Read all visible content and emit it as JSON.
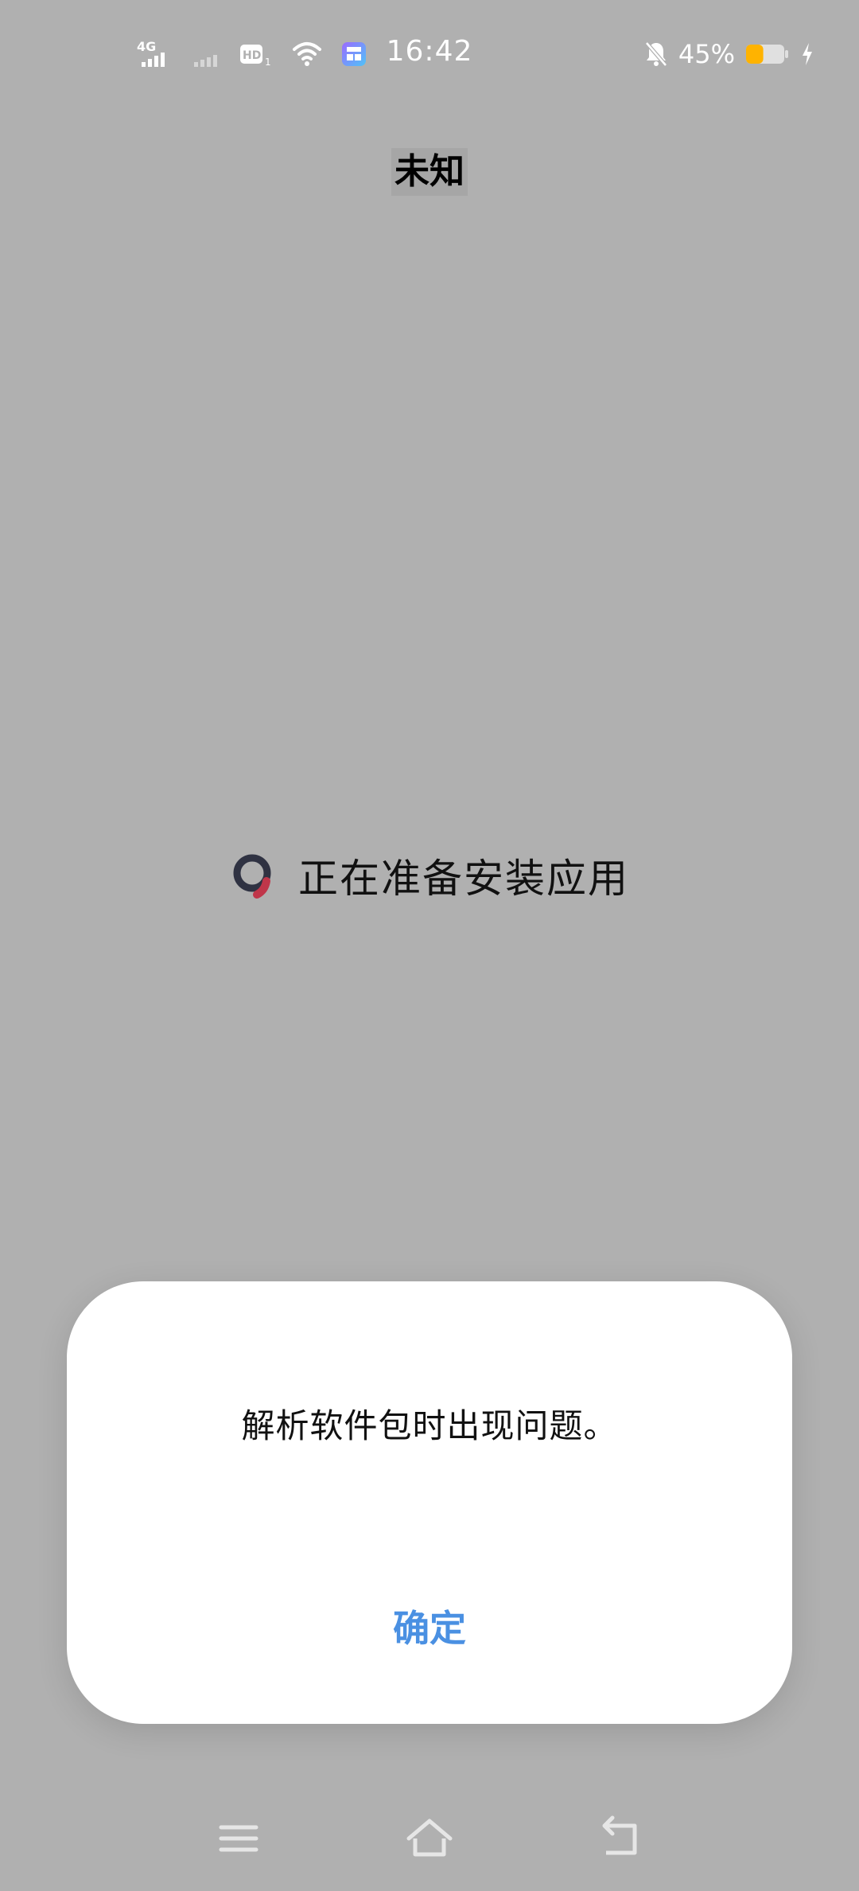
{
  "status_bar": {
    "time": "16:42",
    "network_label": "4G",
    "hd_label": "HD",
    "hd_sub": "1",
    "battery_percent": "45%",
    "battery_level": 0.45,
    "battery_color": "#ffb300"
  },
  "title": "未知",
  "preparing": {
    "text": "正在准备安装应用",
    "spinner_icon": "loading-spinner-icon"
  },
  "dialog": {
    "message": "解析软件包时出现问题。",
    "confirm_label": "确定",
    "accent_color": "#4a90e2"
  },
  "nav": {
    "menu_icon": "menu-icon",
    "home_icon": "home-icon",
    "back_icon": "back-icon"
  }
}
